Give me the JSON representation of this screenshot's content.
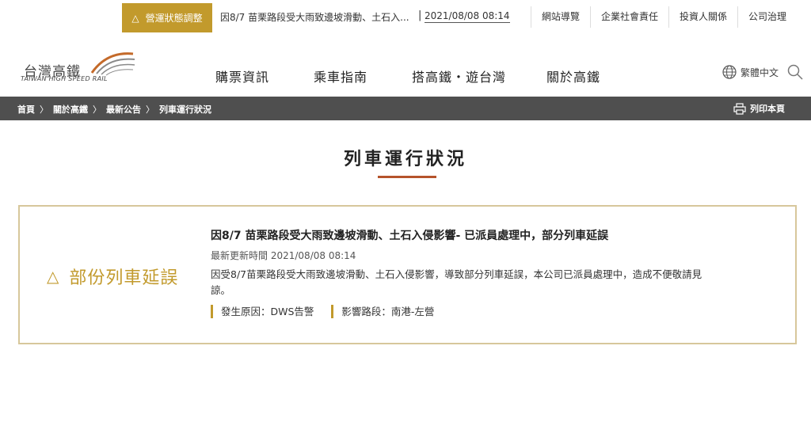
{
  "alert": {
    "tag": "營運狀態調整",
    "text": "因8/7 苗栗路段受大雨致邊坡滑動、土石入...",
    "time": "2021/08/08 08:14"
  },
  "util_links": [
    "網站導覽",
    "企業社會責任",
    "投資人關係",
    "公司治理"
  ],
  "logo": {
    "zh": "台灣高鐵",
    "en": "TAIWAN HIGH SPEED RAIL"
  },
  "nav": [
    "購票資訊",
    "乘車指南",
    "搭高鐵・遊台灣",
    "關於高鐵"
  ],
  "lang": "繁體中文",
  "breadcrumb": [
    "首頁",
    "關於高鐵",
    "最新公告",
    "列車運行狀況"
  ],
  "print_label": "列印本頁",
  "page_title": "列車運行狀況",
  "notice": {
    "status": "部份列車延誤",
    "title": "因8/7 苗栗路段受大雨致邊坡滑動、土石入侵影響- 已派員處理中，部分列車延誤",
    "updated_label": "最新更新時間",
    "updated_time": "2021/08/08 08:14",
    "body": "因受8/7苗栗路段受大雨致邊坡滑動、土石入侵影響，導致部分列車延誤，本公司已派員處理中，造成不便敬請見諒。",
    "cause": "發生原因：DWS告警",
    "section": "影響路段：南港-左營"
  },
  "colors": {
    "accent": "#c29a2c",
    "breadcrumb_bg": "#4f4f4f",
    "title_underline": "#b5532b",
    "box_border": "#d7c79b"
  }
}
